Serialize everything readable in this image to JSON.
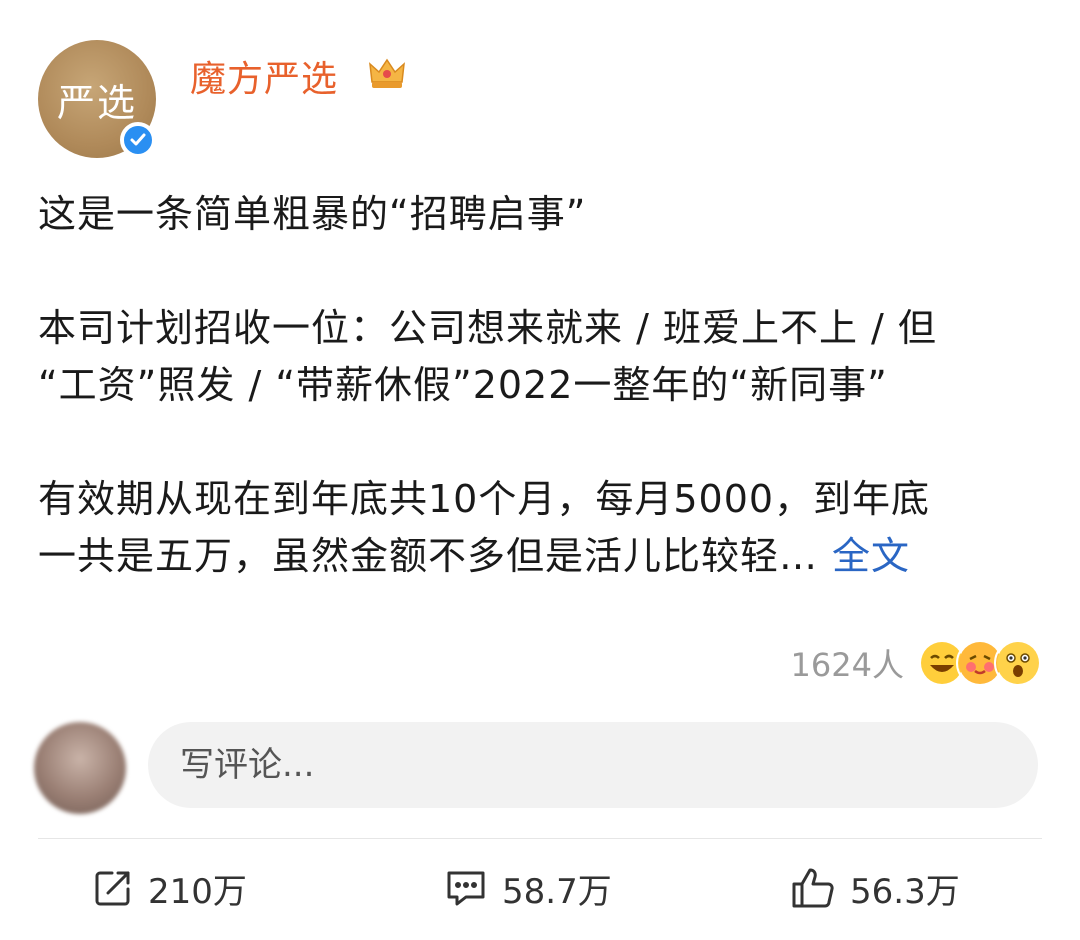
{
  "account": {
    "avatar_text": "严选",
    "name": "魔方严选",
    "badges": [
      "verified-icon",
      "crown-icon"
    ]
  },
  "post": {
    "line1": "这是一条简单粗暴的“招聘启事”",
    "para2_a": "本司计划招收一位：公司想来就来 / 班爱上不上 / 但",
    "para2_b": "“工资”照发 / “带薪休假”2022一整年的“新同事”",
    "para3_a": "有效期从现在到年底共10个月，每月5000，到年底",
    "para3_b": "一共是五万，虽然金额不多但是活儿比较轻…",
    "expand_label": "全文"
  },
  "reactions": {
    "count": "1624人",
    "emojis": [
      "laugh-emoji",
      "blush-emoji",
      "shocked-emoji"
    ]
  },
  "comment": {
    "placeholder": "写评论..."
  },
  "actions": {
    "share": "210万",
    "comments": "58.7万",
    "likes": "56.3万"
  },
  "colors": {
    "username": "#e8612c",
    "link": "#2a66c4",
    "verified": "#2a8ff2"
  }
}
